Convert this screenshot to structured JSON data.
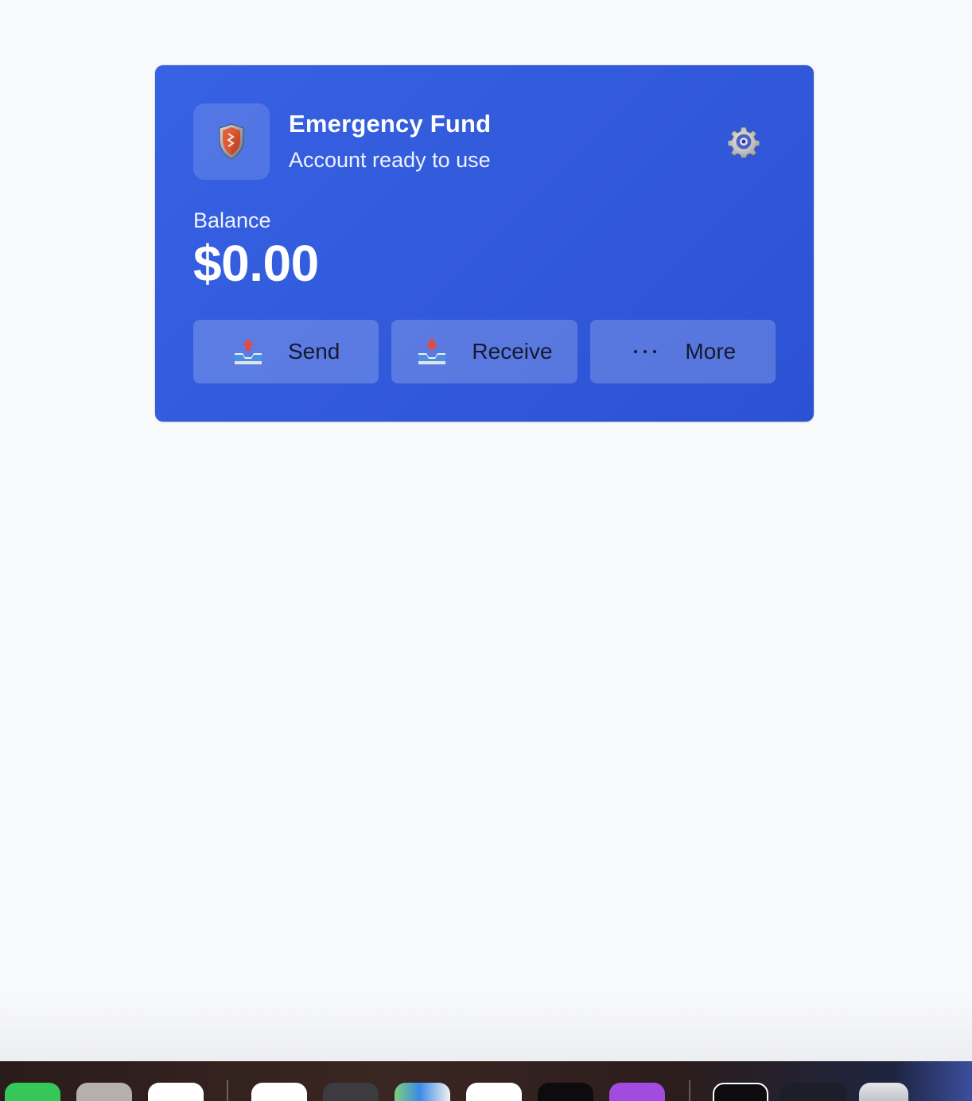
{
  "account": {
    "title": "Emergency Fund",
    "subtitle": "Account ready to use",
    "icon": "shield-icon",
    "settings_icon": "gear-icon"
  },
  "balance": {
    "label": "Balance",
    "amount": "$0.00"
  },
  "actions": [
    {
      "label": "Send",
      "icon": "outbox-tray-icon"
    },
    {
      "label": "Receive",
      "icon": "inbox-tray-icon"
    },
    {
      "label": "More",
      "icon": "ellipsis-icon"
    }
  ],
  "colors": {
    "card_start": "#3762e3",
    "card_end": "#2c52d3",
    "page_background": "#f8f9fb",
    "button_text": "#151a2e"
  },
  "dock": {
    "apps": [
      "messages-icon",
      "activity-icon",
      "app-icon",
      "app-icon",
      "keyboard-app-icon",
      "maps-icon",
      "app-icon",
      "app-icon",
      "podcasts-icon",
      "app-icon",
      "window-preview-icon",
      "trash-icon"
    ]
  }
}
